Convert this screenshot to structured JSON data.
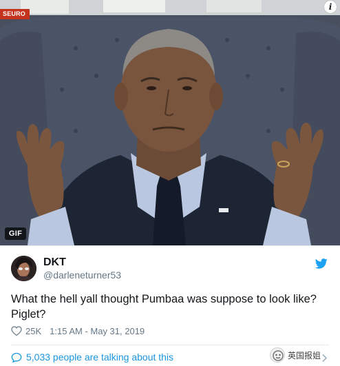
{
  "media": {
    "type_badge": "GIF",
    "source_tag": "SEURO",
    "info_icon": "info-icon",
    "info_glyph": "i"
  },
  "tweet": {
    "display_name": "DKT",
    "handle": "@darleneturner53",
    "text": "What the hell yall thought Pumbaa was suppose to look like? Piglet?",
    "likes": "25K",
    "timestamp": "1:15 AM - May 31, 2019",
    "talking": "5,033 people are talking about this",
    "brand_color": "#1da1f2",
    "link_color": "#1b95e0",
    "secondary_text_color": "#657786"
  },
  "watermark": {
    "text": "英国报姐"
  }
}
